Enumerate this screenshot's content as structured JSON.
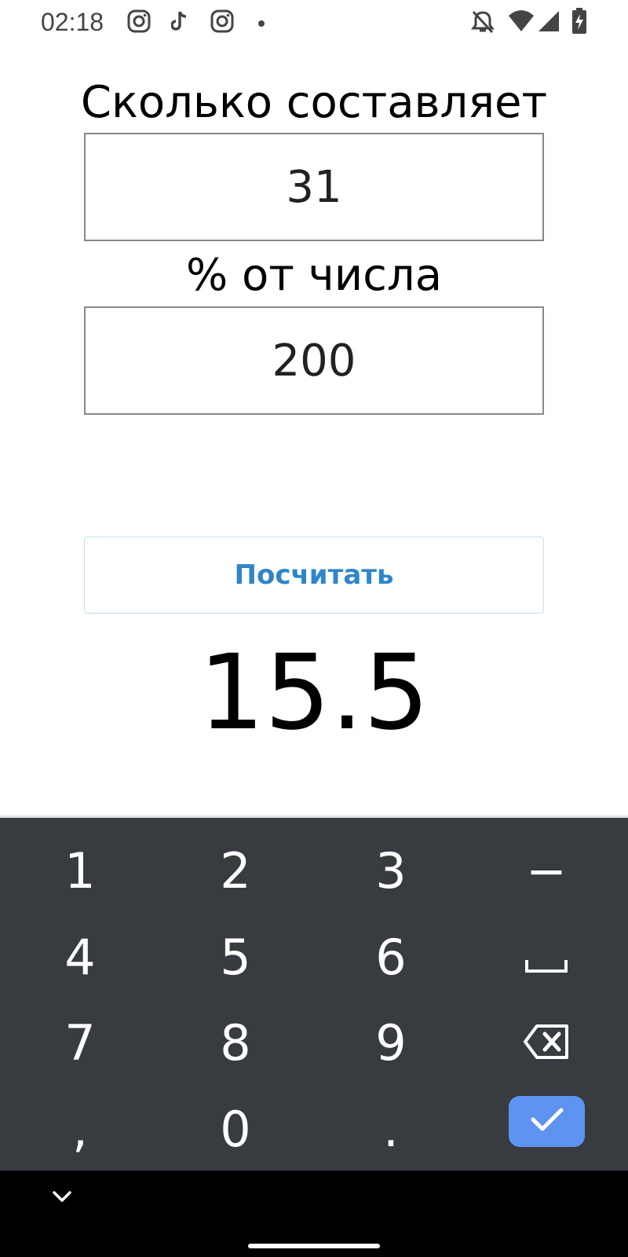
{
  "status_bar": {
    "time": "02:18",
    "left_icons": [
      "instagram-icon",
      "tiktok-icon",
      "instagram-icon",
      "dot-icon"
    ],
    "right_icons": [
      "bell-off-icon",
      "wifi-icon",
      "signal-icon",
      "battery-charging-icon"
    ]
  },
  "form": {
    "label_top": "Сколько составляет",
    "percent_value": "31",
    "label_middle": "% от числа",
    "number_value": "200",
    "button_label": "Посчитать",
    "result": "15.5"
  },
  "colors": {
    "accent": "#2e86c9",
    "keyboard_bg": "#383b40",
    "done_key": "#5f93f2"
  },
  "keyboard": {
    "keys": [
      {
        "label": "1"
      },
      {
        "label": "2"
      },
      {
        "label": "3"
      },
      {
        "label": "−"
      },
      {
        "label": "4"
      },
      {
        "label": "5"
      },
      {
        "label": "6"
      },
      {
        "label": "space-icon"
      },
      {
        "label": "7"
      },
      {
        "label": "8"
      },
      {
        "label": "9"
      },
      {
        "label": "backspace-icon"
      },
      {
        "label": ","
      },
      {
        "label": "0"
      },
      {
        "label": "."
      },
      {
        "label": "checkmark-icon"
      }
    ]
  },
  "nav_bar": {
    "icons": [
      "chevron-down-icon",
      "home-handle-icon"
    ]
  }
}
